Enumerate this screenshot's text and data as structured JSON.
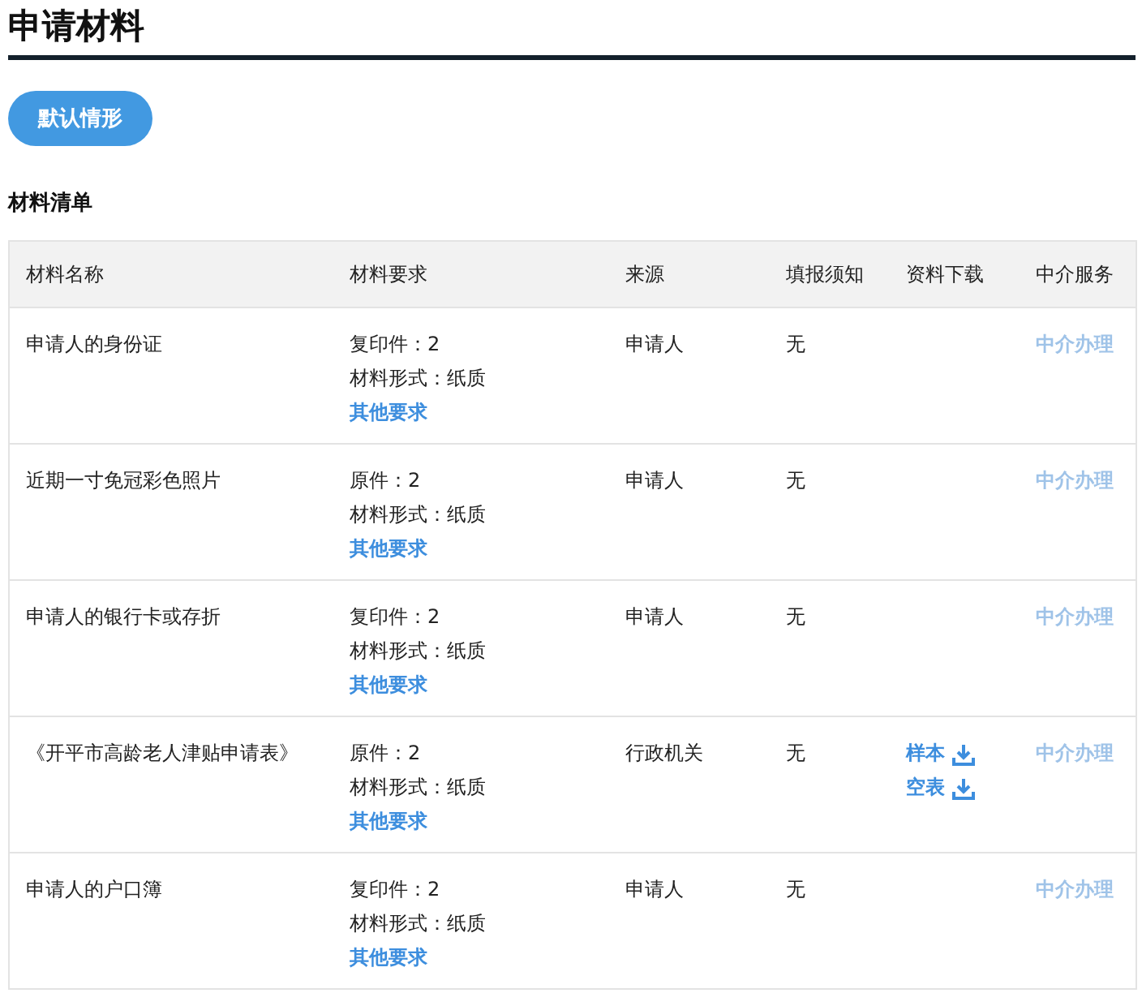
{
  "title": "申请材料",
  "scenario_button": {
    "label": "默认情形",
    "selected": true
  },
  "section_title": "材料清单",
  "table": {
    "columns": [
      "材料名称",
      "材料要求",
      "来源",
      "填报须知",
      "资料下载",
      "中介服务"
    ],
    "rows": [
      {
        "name": "申请人的身份证",
        "requirements": [
          "复印件：2",
          "材料形式：纸质"
        ],
        "more_link": "其他要求",
        "source": "申请人",
        "notice": "无",
        "downloads": [],
        "service": {
          "label": "中介办理",
          "disabled": true
        }
      },
      {
        "name": "近期一寸免冠彩色照片",
        "requirements": [
          "原件：2",
          "材料形式：纸质"
        ],
        "more_link": "其他要求",
        "source": "申请人",
        "notice": "无",
        "downloads": [],
        "service": {
          "label": "中介办理",
          "disabled": true
        }
      },
      {
        "name": "申请人的银行卡或存折",
        "requirements": [
          "复印件：2",
          "材料形式：纸质"
        ],
        "more_link": "其他要求",
        "source": "申请人",
        "notice": "无",
        "downloads": [],
        "service": {
          "label": "中介办理",
          "disabled": true
        }
      },
      {
        "name": "《开平市高龄老人津贴申请表》",
        "requirements": [
          "原件：2",
          "材料形式：纸质"
        ],
        "more_link": "其他要求",
        "source": "行政机关",
        "notice": "无",
        "downloads": [
          "样本",
          "空表"
        ],
        "service": {
          "label": "中介办理",
          "disabled": true
        }
      },
      {
        "name": "申请人的户口簿",
        "requirements": [
          "复印件：2",
          "材料形式：纸质"
        ],
        "more_link": "其他要求",
        "source": "申请人",
        "notice": "无",
        "downloads": [],
        "service": {
          "label": "中介办理",
          "disabled": true
        }
      }
    ]
  }
}
